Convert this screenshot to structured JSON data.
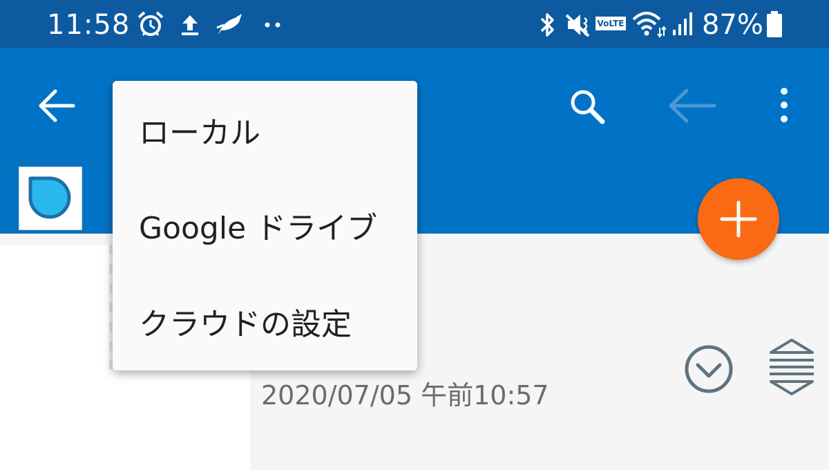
{
  "status_bar": {
    "time": "11:58",
    "battery": "87%",
    "volte_label": "VoLTE",
    "icons": [
      "alarm-icon",
      "upload-icon",
      "app-notification-icon",
      "more-dots-icon",
      "bluetooth-icon",
      "mute-icon",
      "volte-icon",
      "wifi-icon",
      "signal-icon",
      "battery-icon"
    ],
    "background": "#0d5aa0"
  },
  "app_bar": {
    "background": "#0173c6",
    "icons": [
      "back-arrow-icon",
      "search-icon",
      "back-arrow-disabled-icon",
      "overflow-menu-icon"
    ]
  },
  "dropdown_menu": {
    "items": [
      {
        "label": "ローカル"
      },
      {
        "label": "Google ドライブ"
      },
      {
        "label": "クラウドの設定"
      }
    ]
  },
  "file_row": {
    "date": "2020/07/05 午前10:57",
    "icons": [
      "expand-circle-icon",
      "reorder-icon"
    ]
  },
  "fab": {
    "icon": "plus-icon",
    "color": "#fa6a12"
  },
  "colors": {
    "accent": "#0173c6",
    "status_bar": "#0d5aa0",
    "fab": "#fa6a12"
  }
}
